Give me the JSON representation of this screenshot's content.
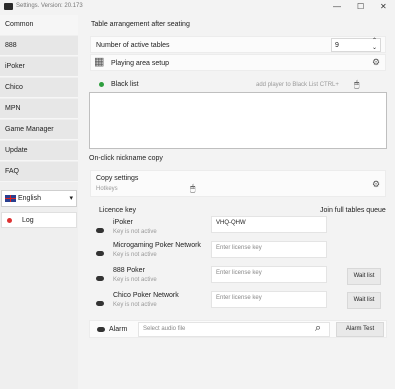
{
  "window": {
    "title": "Settings. Version: 20.173",
    "min": "—",
    "max": "☐",
    "close": "✕"
  },
  "sidebar": {
    "items": [
      {
        "label": "Common"
      },
      {
        "label": "888"
      },
      {
        "label": "iPoker"
      },
      {
        "label": "Chico"
      },
      {
        "label": "MPN"
      },
      {
        "label": "Game Manager"
      },
      {
        "label": "Update"
      },
      {
        "label": "FAQ"
      }
    ],
    "language": "English",
    "log": "Log"
  },
  "main": {
    "table_arrangement_title": "Table arrangement after seating",
    "active_tables_label": "Number of active tables",
    "active_tables_value": "9",
    "playing_area_label": "Playing area setup",
    "black_list_label": "Black list",
    "black_list_hint": "add player to Black List CTRL+",
    "nickname_copy_title": "On-click nickname copy",
    "copy_settings_label": "Copy settings",
    "hotkeys_label": "Hotkeys",
    "licence_title": "Licence key",
    "join_queue_title": "Join full tables queue",
    "licences": [
      {
        "name": "iPoker",
        "status": "Key is not active",
        "key": "VHQ-QHW",
        "wait": ""
      },
      {
        "name": "Microgaming Poker Network",
        "status": "Key is not active",
        "key": "Enter license key",
        "wait": ""
      },
      {
        "name": "888 Poker",
        "status": "Key is not active",
        "key": "Enter license key",
        "wait": "Wait list"
      },
      {
        "name": "Chico Poker Network",
        "status": "Key is not active",
        "key": "Enter license key",
        "wait": "Wait list"
      }
    ],
    "alarm_label": "Alarm",
    "audio_placeholder": "Select audio file",
    "alarm_test": "Alarm Test"
  },
  "colors": {
    "accent_dot": "#2e9e3e",
    "log_dot": "#d33333"
  }
}
